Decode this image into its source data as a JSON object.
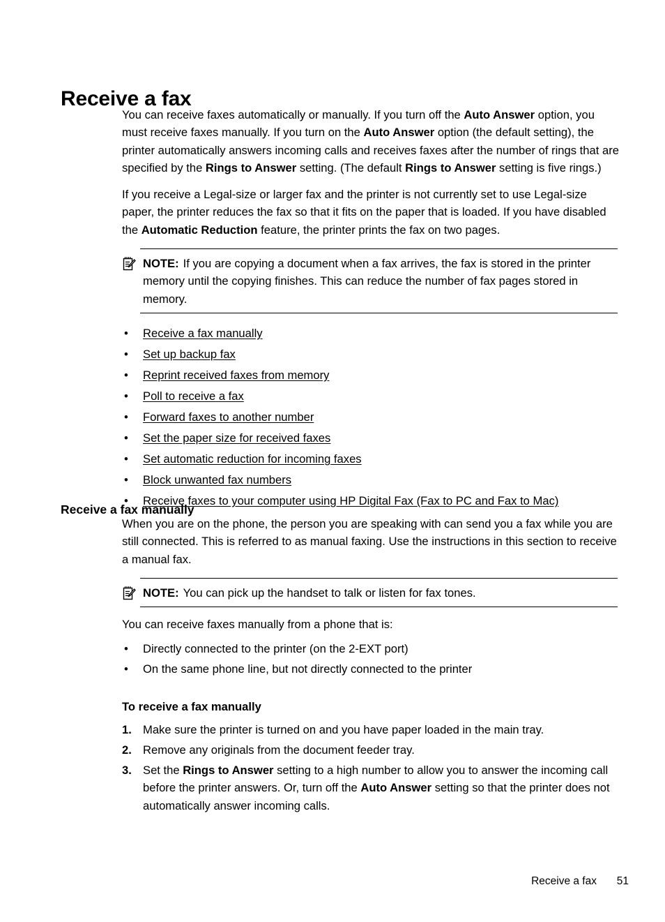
{
  "page": {
    "chapter_title": "Receive a fax",
    "footer_title": "Receive a fax",
    "footer_page_number": "51"
  },
  "intro": {
    "paragraph1": {
      "seg1": "You can receive faxes automatically or manually. If you turn off the ",
      "bold1": "Auto Answer",
      "seg2": " option, you must receive faxes manually. If you turn on the ",
      "bold2": "Auto Answer",
      "seg3": " option (the default setting), the printer automatically answers incoming calls and receives faxes after the number of rings that are specified by the ",
      "bold3": "Rings to Answer",
      "seg4": " setting. (The default ",
      "bold4": "Rings to Answer",
      "seg5": " setting is five rings.)"
    },
    "paragraph2": {
      "seg1": "If you receive a Legal-size or larger fax and the printer is not currently set to use Legal-size paper, the printer reduces the fax so that it fits on the paper that is loaded. If you have disabled the ",
      "bold1": "Automatic Reduction",
      "seg2": " feature, the printer prints the fax on two pages."
    },
    "note": {
      "icon": "note-pad-pencil-icon",
      "label": "NOTE:",
      "text": "If you are copying a document when a fax arrives, the fax is stored in the printer memory until the copying finishes. This can reduce the number of fax pages stored in memory."
    }
  },
  "topic_links": {
    "bullet": "•",
    "items": [
      {
        "label": "Receive a fax manually"
      },
      {
        "label": "Set up backup fax"
      },
      {
        "label": "Reprint received faxes from memory"
      },
      {
        "label": "Poll to receive a fax"
      },
      {
        "label": "Forward faxes to another number"
      },
      {
        "label": "Set the paper size for received faxes"
      },
      {
        "label": "Set automatic reduction for incoming faxes"
      },
      {
        "label": "Block unwanted fax numbers"
      },
      {
        "label": "Receive faxes to your computer using HP Digital Fax (Fax to PC and Fax to Mac)"
      }
    ]
  },
  "manual_section": {
    "heading": "Receive a fax manually",
    "paragraph1": "When you are on the phone, the person you are speaking with can send you a fax while you are still connected. This is referred to as manual faxing. Use the instructions in this section to receive a manual fax.",
    "note": {
      "icon": "note-pad-pencil-icon",
      "label": "NOTE:",
      "text": "You can pick up the handset to talk or listen for fax tones."
    },
    "lead_in": "You can receive faxes manually from a phone that is:",
    "bullet": "•",
    "conditions": [
      {
        "label": "Directly connected to the printer (on the 2-EXT port)"
      },
      {
        "label": "On the same phone line, but not directly connected to the printer"
      }
    ],
    "procedure_heading": "To receive a fax manually",
    "steps": [
      {
        "number": "1.",
        "seg1": "Make sure the printer is turned on and you have paper loaded in the main tray.",
        "bold1": "",
        "seg2": "",
        "bold2": "",
        "seg3": ""
      },
      {
        "number": "2.",
        "seg1": "Remove any originals from the document feeder tray.",
        "bold1": "",
        "seg2": "",
        "bold2": "",
        "seg3": ""
      },
      {
        "number": "3.",
        "seg1": "Set the ",
        "bold1": "Rings to Answer",
        "seg2": " setting to a high number to allow you to answer the incoming call before the printer answers. Or, turn off the ",
        "bold2": "Auto Answer",
        "seg3": " setting so that the printer does not automatically answer incoming calls."
      }
    ]
  }
}
